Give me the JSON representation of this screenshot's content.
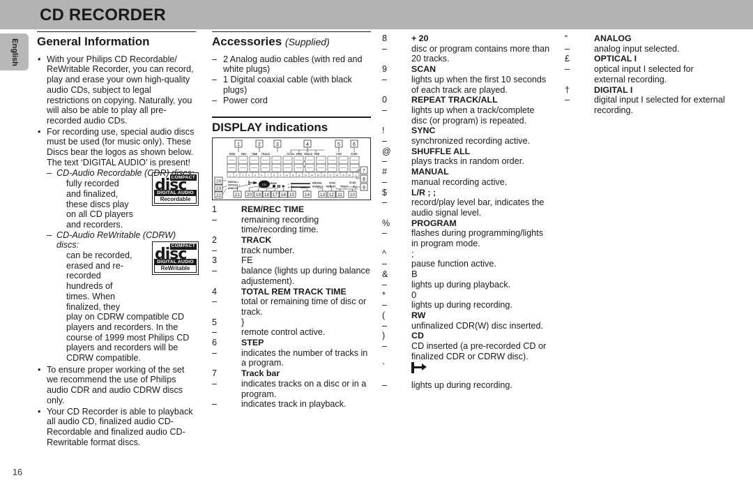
{
  "header": {
    "title": "CD RECORDER"
  },
  "lang_tab": {
    "label": "English"
  },
  "page_number": "16",
  "col1": {
    "heading": "General Information",
    "bullets": [
      "With your Philips CD Recordable/ ReWritable Recorder, you can record, play and erase your own high-quality audio CDs, subject to legal restrictions on copying. Naturally, you will also be able to play all pre-recorded audio CDs.",
      "For recording use, special audio discs must be used (for music only). These Discs bear the logos as shown below. The text ‘DIGITAL AUDIO’ is present!"
    ],
    "sub1": {
      "head": "CD-Audio Recordable (CDR) discs:",
      "body": "fully recorded and finalized, these discs play on all CD players and recorders."
    },
    "sub2": {
      "head": "CD-Audio ReWritable (CDRW) discs:",
      "body_indent": "can be recorded, erased and re-recorded hundreds of times. When finalized, they",
      "body_full": "play on CDRW compatible CD players and recorders. In the course of 1999 most Philips CD players and recorders will be CDRW compatible."
    },
    "bullets2": [
      "To ensure proper working of the set we recommend the use of Philips audio CDR and audio CDRW discs only.",
      "Your CD Recorder is able to playback all audio CD,  finalized audio CD-Recordable and finalized audio CD-Rewritable format discs."
    ],
    "logo_cdr": {
      "compact": "COMPACT",
      "disc": "disc",
      "digital_audio": "DIGITAL AUDIO",
      "kind": "Recordable"
    },
    "logo_cdrw": {
      "compact": "COMPACT",
      "disc": "disc",
      "digital_audio": "DIGITAL AUDIO",
      "kind": "ReWritable"
    }
  },
  "col2": {
    "accessories_heading": "Accessories",
    "accessories_supplied": "(Supplied)",
    "accessories": [
      "2 Analog audio cables (with red and white plugs)",
      "1 Digital coaxial cable (with black plugs)",
      "Power cord"
    ],
    "display_heading": "DISPLAY indications",
    "display_figure": {
      "top_labels": [
        "REM",
        "REC",
        "TIME",
        "TRACK",
        "TOTAL",
        "REM",
        "TRACK",
        "TIME",
        "OVR",
        "STEP"
      ],
      "callouts_top": [
        "1",
        "2",
        "3",
        "4",
        "5",
        "6"
      ],
      "callouts_right": [
        "7",
        "8",
        "9"
      ],
      "callouts_bottom": [
        "21",
        "20",
        "19",
        "18",
        "17",
        "16",
        "15",
        "14",
        "13",
        "12",
        "11",
        "10"
      ],
      "callouts_left": [
        "24",
        "23",
        "22"
      ],
      "indicator_labels": [
        "DIGITAL I",
        "OPTICAL I",
        "ANALOG",
        "RW",
        "PROGRAM",
        "MIN BAL",
        "SHUFFLE",
        "SYNC",
        "REPEAT",
        "TRACK",
        "ALL",
        "SCAN"
      ],
      "track_numbers": [
        "1",
        "2",
        "3",
        "4",
        "5",
        "6",
        "7",
        "8",
        "9",
        "10",
        "11",
        "12",
        "13",
        "14",
        "15",
        "16",
        "17",
        "18",
        "19",
        "20",
        "+"
      ]
    },
    "items": [
      {
        "mark": "1",
        "term": "REM/REC TIME",
        "bold": true,
        "descs": [
          "remaining recording time/recording time."
        ]
      },
      {
        "mark": "2",
        "term": "TRACK",
        "bold": true,
        "descs": [
          "track number."
        ]
      },
      {
        "mark": "3",
        "term": "FE",
        "bold": false,
        "descs": [
          "balance (lights up during balance adjustement)."
        ]
      },
      {
        "mark": "4",
        "term": "TOTAL REM TRACK TIME",
        "bold": true,
        "descs": [
          "total or remaining time of disc or track."
        ]
      },
      {
        "mark": "5",
        "term": "}",
        "bold": false,
        "descs": [
          "remote control active."
        ]
      },
      {
        "mark": "6",
        "term": "STEP",
        "bold": true,
        "descs": [
          "indicates the number of tracks in a program."
        ]
      },
      {
        "mark": "7",
        "term": "Track bar",
        "bold": true,
        "descs": [
          "indicates tracks on a disc or in a program.",
          "indicates track in playback."
        ]
      }
    ]
  },
  "col3": {
    "items": [
      {
        "mark": "8",
        "term": "+ 20",
        "bold": true,
        "descs": [
          "disc or program contains more than 20 tracks."
        ]
      },
      {
        "mark": "9",
        "term": "SCAN",
        "bold": true,
        "descs": [
          "lights up when the first 10 seconds of each track are played."
        ]
      },
      {
        "mark": "0",
        "term": "REPEAT TRACK/ALL",
        "bold": true,
        "descs": [
          "lights up when a track/complete disc (or program) is repeated."
        ]
      },
      {
        "mark": "!",
        "term": "SYNC",
        "bold": true,
        "descs": [
          "synchronized recording active."
        ]
      },
      {
        "mark": "@",
        "term": "SHUFFLE ALL",
        "bold": true,
        "descs": [
          "plays tracks in random order."
        ]
      },
      {
        "mark": "#",
        "term": "MANUAL",
        "bold": true,
        "descs": [
          "manual recording active."
        ]
      },
      {
        "mark": "$",
        "term": "L/R ;  ;",
        "bold": true,
        "descs": [
          "record/play level bar, indicates the audio signal level."
        ]
      },
      {
        "mark": "%",
        "term": "PROGRAM",
        "bold": true,
        "descs": [
          "flashes during programming/lights in program mode."
        ]
      },
      {
        "mark": "^",
        "term": ";",
        "bold": false,
        "descs": [
          "pause function active."
        ]
      },
      {
        "mark": "&",
        "term": "B",
        "bold": false,
        "descs": [
          "lights up during playback."
        ]
      },
      {
        "mark": "*",
        "term": "0",
        "bold": false,
        "descs": [
          "lights up during recording."
        ]
      },
      {
        "mark": "(",
        "term": "RW",
        "bold": true,
        "descs": [
          "unfinalized CDR(W) disc inserted."
        ]
      },
      {
        "mark": ")",
        "term": "CD",
        "bold": true,
        "descs": [
          "CD inserted (a pre-recorded CD or finalized CDR or CDRW disc)."
        ]
      },
      {
        "mark": "`",
        "term": "",
        "icon": "record-arrow-icon",
        "bold": false,
        "descs": [
          "lights up during recording."
        ]
      }
    ]
  },
  "col4": {
    "items": [
      {
        "mark": "“",
        "term": "ANALOG",
        "bold": true,
        "descs": [
          "analog input selected."
        ]
      },
      {
        "mark": "£",
        "term": "OPTICAL  I",
        "bold": true,
        "descs": [
          "optical input I selected for external recording."
        ]
      },
      {
        "mark": "†",
        "term": "DIGITAL  I",
        "bold": true,
        "descs": [
          "digital input I selected for external recording."
        ]
      }
    ]
  }
}
